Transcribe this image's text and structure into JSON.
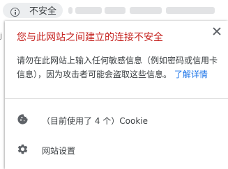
{
  "address_bar": {
    "not_secure_label": "不安全",
    "icon": "info-icon"
  },
  "popup": {
    "title": "您与此网站之间建立的连接不安全",
    "description": "请勿在此网站上输入任何敏感信息（例如密码或信用卡信息），因为攻击者可能会盗取这些信息。",
    "learn_more": "了解详情",
    "cookie_row": {
      "label": "（目前使用了 4 个）Cookie",
      "icon": "cookie-icon"
    },
    "settings_row": {
      "label": "网站设置",
      "icon": "gear-icon"
    },
    "close_icon": "close-icon"
  },
  "colors": {
    "title_red": "#c5221f",
    "link_blue": "#1a73e8",
    "text": "#3c4043",
    "pill_bg": "#eceef0"
  }
}
